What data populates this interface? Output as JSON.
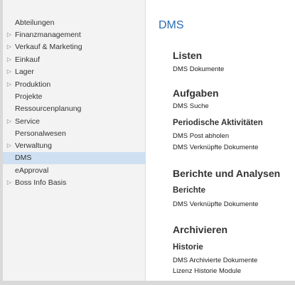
{
  "sidebar": {
    "items": [
      {
        "label": "Abteilungen",
        "chevron": false
      },
      {
        "label": "Finanzmanagement",
        "chevron": true
      },
      {
        "label": "Verkauf & Marketing",
        "chevron": true
      },
      {
        "label": "Einkauf",
        "chevron": true
      },
      {
        "label": "Lager",
        "chevron": true
      },
      {
        "label": "Produktion",
        "chevron": true
      },
      {
        "label": "Projekte",
        "chevron": false
      },
      {
        "label": "Ressourcenplanung",
        "chevron": false
      },
      {
        "label": "Service",
        "chevron": true
      },
      {
        "label": "Personalwesen",
        "chevron": false
      },
      {
        "label": "Verwaltung",
        "chevron": true
      },
      {
        "label": "DMS",
        "chevron": false,
        "selected": true
      },
      {
        "label": "eApproval",
        "chevron": false
      },
      {
        "label": "Boss Info Basis",
        "chevron": true
      }
    ],
    "chevron_glyph": "▷"
  },
  "main": {
    "title": "DMS",
    "listen": {
      "title": "Listen",
      "links": [
        "DMS Dokumente"
      ]
    },
    "aufgaben": {
      "title": "Aufgaben",
      "links": [
        "DMS Suche"
      ]
    },
    "periodische": {
      "title": "Periodische Aktivitäten",
      "links": [
        "DMS Post abholen",
        "DMS Verknüpfte Dokumente"
      ]
    },
    "berichte_analysen": {
      "title": "Berichte und Analysen"
    },
    "berichte": {
      "title": "Berichte",
      "links": [
        "DMS Verknüpfte Dokumente"
      ]
    },
    "archivieren": {
      "title": "Archivieren"
    },
    "historie": {
      "title": "Historie",
      "links": [
        "DMS Archivierte Dokumente",
        "Lizenz Historie Module"
      ]
    }
  },
  "colors": {
    "accent": "#2a6cb3",
    "selected_bg": "#cfe0f2",
    "sidebar_bg": "#f3f3f3"
  }
}
